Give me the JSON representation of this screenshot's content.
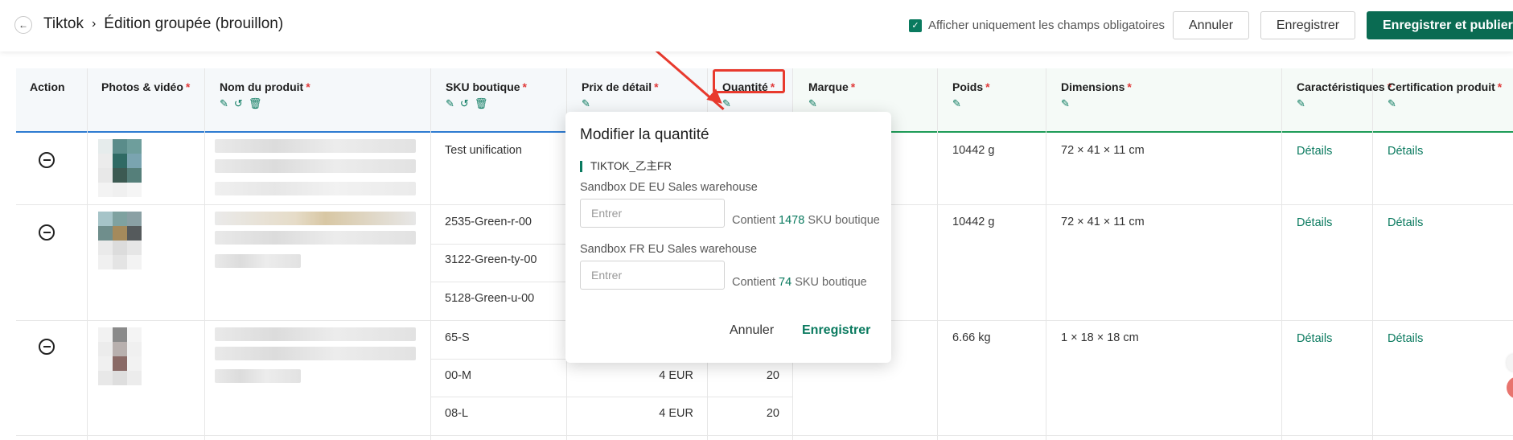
{
  "header": {
    "breadcrumb_root": "Tiktok",
    "breadcrumb_page": "Édition groupée (brouillon)",
    "checkbox_label": "Afficher uniquement les champs obligatoires",
    "cancel": "Annuler",
    "save": "Enregistrer",
    "publish": "Enregistrer et publier"
  },
  "columns": {
    "action": "Action",
    "photos": "Photos & vidéo",
    "product_name": "Nom du produit",
    "sku": "SKU boutique",
    "price": "Prix de détail",
    "quantity": "Quantité",
    "brand": "Marque",
    "weight": "Poids",
    "dimensions": "Dimensions",
    "characteristics": "Caractéristiques",
    "certification": "Certification produit"
  },
  "rows": [
    {
      "skus": [
        "Test unification"
      ],
      "weight": "10442 g",
      "dimensions": "72 × 41 × 11 cm",
      "detail1": "Détails",
      "detail2": "Détails"
    },
    {
      "skus": [
        "2535-Green-r-00",
        "3122-Green-ty-00",
        "5128-Green-u-00"
      ],
      "weight": "10442 g",
      "dimensions": "72 × 41 × 11 cm",
      "detail1": "Détails",
      "detail2": "Détails"
    },
    {
      "skus": [
        "65-S",
        "00-M",
        "08-L"
      ],
      "prices": [
        "",
        "4 EUR",
        "4 EUR"
      ],
      "quantities": [
        "",
        "20",
        "20"
      ],
      "weight": "6.66 kg",
      "dimensions": "1 × 18 × 18 cm",
      "detail1": "Détails",
      "detail2": "Détails"
    }
  ],
  "popover": {
    "title": "Modifier la quantité",
    "shop": "TIKTOK_乙主FR",
    "warehouses": [
      {
        "name": "Sandbox DE EU Sales warehouse",
        "placeholder": "Entrer",
        "contains_prefix": "Contient",
        "count": "1478",
        "contains_suffix": "SKU boutique"
      },
      {
        "name": "Sandbox FR EU Sales warehouse",
        "placeholder": "Entrer",
        "contains_prefix": "Contient",
        "count": "74",
        "contains_suffix": "SKU boutique"
      }
    ],
    "cancel": "Annuler",
    "save": "Enregistrer"
  },
  "icons": {
    "back": "arrow-left-icon",
    "edit": "pencil-icon",
    "reset": "undo-icon",
    "delete": "trash-icon",
    "remove_row": "minus-circle-icon"
  },
  "colors": {
    "accent": "#0a7a5f",
    "required": "#e03a3a",
    "highlight": "#e83a2e"
  }
}
